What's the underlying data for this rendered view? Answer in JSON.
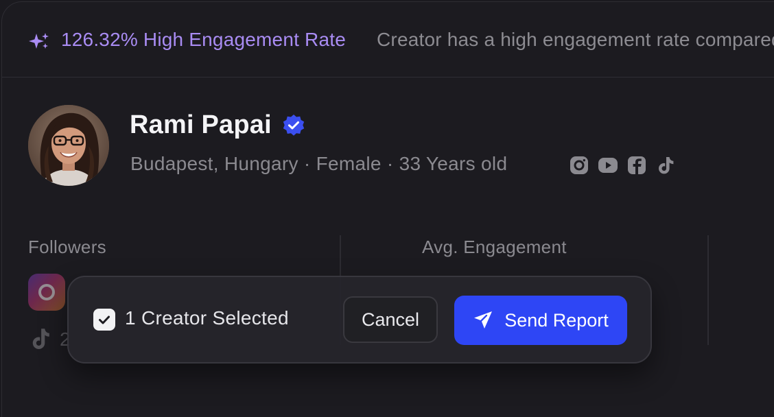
{
  "insight": {
    "rate_text": "126.32% High Engagement Rate",
    "description": "Creator has a high engagement rate  compared"
  },
  "profile": {
    "name": "Rami Papai",
    "location": "Budapest, Hungary",
    "gender": "Female",
    "age": "33 Years old",
    "separator": " · ",
    "social_icons": [
      "instagram-icon",
      "youtube-icon",
      "facebook-icon",
      "tiktok-icon"
    ]
  },
  "stats": {
    "followers_label": "Followers",
    "engagement_label": "Avg. Engagement",
    "tiktok_partial": "2"
  },
  "action_bar": {
    "selected_text": "1 Creator Selected",
    "cancel_label": "Cancel",
    "send_label": "Send Report"
  },
  "colors": {
    "accent_purple": "#a98cf3",
    "primary_blue": "#2e46f5",
    "verified_blue": "#3b4ff0",
    "background": "#1c1b20"
  }
}
